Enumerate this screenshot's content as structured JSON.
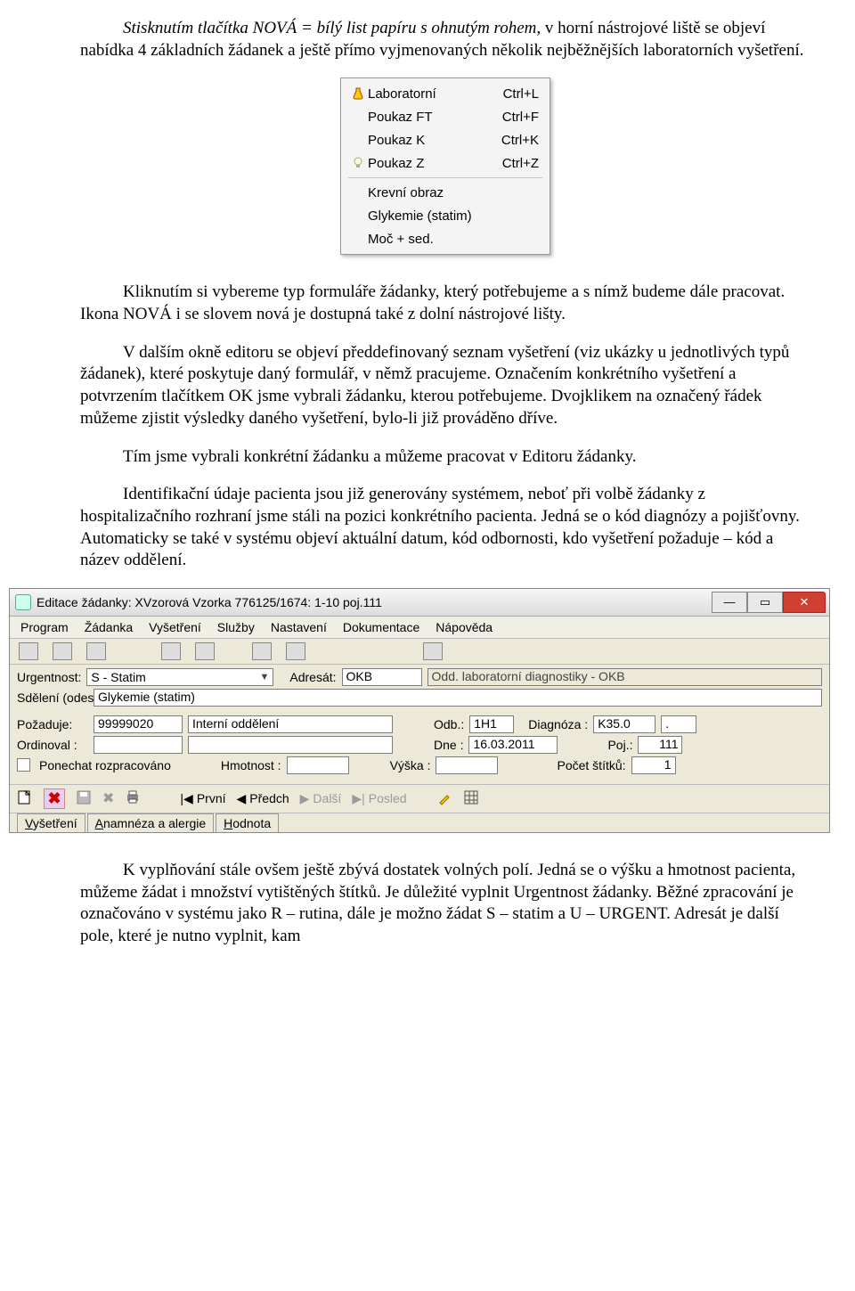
{
  "doc": {
    "p1_lead_italic": "Stisknutím tlačítka NOVÁ = bílý list papíru s ohnutým rohem,",
    "p1_rest": " v horní nástrojové liště se objeví nabídka 4 základních žádanek a ještě přímo vyjmenovaných několik nejběžnějších laboratorních vyšetření.",
    "p2": "Kliknutím si vybereme typ formuláře žádanky, který potřebujeme a s nímž budeme dále pracovat. Ikona NOVÁ i se slovem nová je dostupná také z dolní nástrojové lišty.",
    "p3": "V dalším okně editoru se objeví předdefinovaný seznam vyšetření (viz ukázky u jednotlivých typů žádanek), které poskytuje daný formulář, v němž pracujeme. Označením konkrétního vyšetření a potvrzením tlačítkem OK jsme vybrali žádanku, kterou potřebujeme. Dvojklikem na označený řádek můžeme zjistit výsledky daného vyšetření, bylo-li již prováděno dříve.",
    "p4": "Tím jsme vybrali konkrétní žádanku a můžeme pracovat v Editoru žádanky.",
    "p5": "Identifikační údaje pacienta jsou již generovány systémem, neboť při volbě žádanky z hospitalizačního rozhraní jsme stáli na pozici konkrétního pacienta. Jedná se o kód diagnózy a pojišťovny. Automaticky se také v systému objeví aktuální datum, kód odbornosti, kdo vyšetření požaduje – kód a název oddělení.",
    "p6": "K vyplňování stále ovšem ještě zbývá dostatek volných polí. Jedná se o výšku a hmotnost pacienta, můžeme žádat i množství vytištěných štítků. Je důležité vyplnit Urgentnost žádanky. Běžné zpracování je označováno v systému jako R – rutina, dále je možno žádat S – statim a U – URGENT. Adresát je další pole, které je nutno vyplnit, kam"
  },
  "ctx": {
    "items": [
      {
        "icon": "flask",
        "label": "Laboratorní",
        "accel": "Ctrl+L"
      },
      {
        "icon": "",
        "label": "Poukaz FT",
        "accel": "Ctrl+F"
      },
      {
        "icon": "",
        "label": "Poukaz K",
        "accel": "Ctrl+K"
      },
      {
        "icon": "bulb",
        "label": "Poukaz Z",
        "accel": "Ctrl+Z"
      }
    ],
    "items2": [
      {
        "label": "Krevní obraz"
      },
      {
        "label": "Glykemie (statim)"
      },
      {
        "label": "Moč + sed."
      }
    ]
  },
  "win": {
    "title": "Editace žádanky: XVzorová Vzorka 776125/1674: 1-10 poj.111",
    "menus": [
      "Program",
      "Žádanka",
      "Vyšetření",
      "Služby",
      "Nastavení",
      "Dokumentace",
      "Nápověda"
    ],
    "labels": {
      "urgentnost": "Urgentnost:",
      "adresat": "Adresát:",
      "sdeleni": "Sdělení (odeslán ad):",
      "pozaduje": "Požaduje:",
      "ordinoval": "Ordinoval :",
      "odb": "Odb.:",
      "diagnoza": "Diagnóza :",
      "dne": "Dne :",
      "poj": "Poj.:",
      "ponechat": "Ponechat rozpracováno",
      "hmotnost": "Hmotnost :",
      "vyska": "Výška :",
      "pocet_stitku": "Počet štítků:",
      "prvni": "První",
      "predch": "Předch",
      "dalsi": "Další",
      "posled": "Posled"
    },
    "values": {
      "urgentnost": "S - Statim",
      "adresat": "OKB",
      "adresat_desc": "Odd. laboratorní diagnostiky - OKB",
      "sdeleni": "Glykemie (statim)",
      "pozaduje_kod": "99999020",
      "pozaduje_nazev": "Interní oddělení",
      "odb": "1H1",
      "diagnoza": "K35.0",
      "diagnoza2": ".",
      "dne": "16.03.2011",
      "poj": "111",
      "pocet_stitku": "1"
    },
    "tabs": [
      "Vyšetření",
      "Anamnéza a alergie",
      "Hodnota"
    ]
  }
}
